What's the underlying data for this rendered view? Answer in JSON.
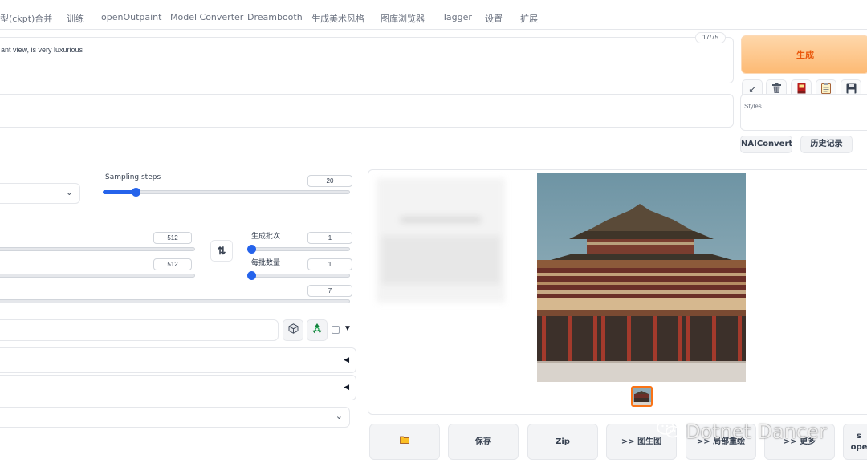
{
  "tabs": [
    "型(ckpt)合并",
    "训练",
    "openOutpaint",
    "Model Converter",
    "Dreambooth",
    "生成美术风格",
    "图库浏览器",
    "Tagger",
    "设置",
    "扩展"
  ],
  "prompt": {
    "value": "ant view, is very luxurious",
    "token_count": "17/75"
  },
  "negative_prompt": {
    "value": ""
  },
  "generate_label": "生成",
  "toolbar": {
    "arrow_icon": "↙",
    "trash_icon": "trash-icon",
    "red_book_icon": "red-book-icon",
    "clipboard_icon": "clipboard-icon",
    "save_icon": "save-icon"
  },
  "styles_label": "Styles",
  "nai_convert_label": "NAIConvert",
  "history_label": "历史记录",
  "sampling": {
    "label": "Sampling steps",
    "value": "20",
    "fraction": 0.133
  },
  "width": {
    "value": "512"
  },
  "height": {
    "value": "512"
  },
  "batch_count": {
    "label": "生成批次",
    "value": "1"
  },
  "batch_size": {
    "label": "每批数量",
    "value": "1"
  },
  "cfg": {
    "value": "7"
  },
  "swap_icon": "⇅",
  "seed": {
    "value": ""
  },
  "accordion_arrow": "◀",
  "dropdown_arrow": "⌄",
  "checkbox_caret": "▼",
  "bottom_buttons": [
    "保存",
    "Zip",
    ">> 图生图",
    ">> 局部重绘",
    ">> 更多",
    "s\nope"
  ],
  "watermark": "Dotnet Dancer",
  "colors": {
    "accent": "#2563eb",
    "generate": "#fdba74",
    "generate_text": "#ea580c"
  }
}
